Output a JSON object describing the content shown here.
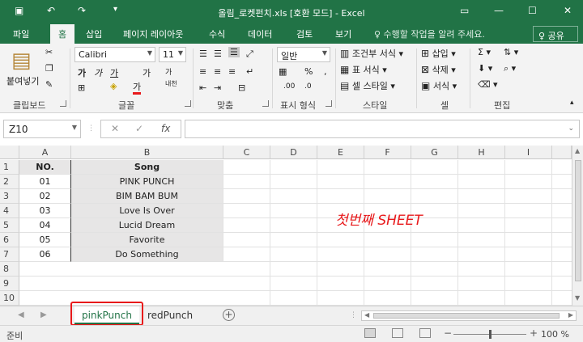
{
  "title": "올림_로켓펀치.xls  [호환 모드] - Excel",
  "ribbon_tabs": [
    "파일",
    "홈",
    "삽입",
    "페이지 레이아웃",
    "수식",
    "데이터",
    "검토",
    "보기"
  ],
  "tell_me": "♀ 수행할 작업을 알려 주세요.",
  "share": "♀ 공유",
  "clipboard": {
    "paste": "붙여넣기",
    "label": "클립보드"
  },
  "font": {
    "name": "Calibri",
    "size": "11",
    "label": "글꼴",
    "bold": "가",
    "italic": "가",
    "underline": "가",
    "grow": "가",
    "shrink": "가",
    "color_a": "가",
    "phonetic": "내천"
  },
  "alignment": {
    "label": "맞춤"
  },
  "number": {
    "format": "일반",
    "percent": "%",
    "comma": ",",
    "label": "표시 형식"
  },
  "styles": {
    "conditional": "조건부 서식",
    "table": "표 서식",
    "cell": "셀 스타일",
    "label": "스타일"
  },
  "cells": {
    "insert": "삽입",
    "delete": "삭제",
    "format": "서식",
    "label": "셀"
  },
  "editing": {
    "label": "편집"
  },
  "name_box": "Z10",
  "fx": "fx",
  "columns": [
    "A",
    "B",
    "C",
    "D",
    "E",
    "F",
    "G",
    "H",
    "I"
  ],
  "rows": [
    "1",
    "2",
    "3",
    "4",
    "5",
    "6",
    "7",
    "8",
    "9",
    "10"
  ],
  "table": {
    "headers": [
      "NO.",
      "Song"
    ],
    "rows": [
      [
        "01",
        "PINK PUNCH"
      ],
      [
        "02",
        "BIM BAM BUM"
      ],
      [
        "03",
        "Love Is Over"
      ],
      [
        "04",
        "Lucid Dream"
      ],
      [
        "05",
        "Favorite"
      ],
      [
        "06",
        "Do Something"
      ]
    ]
  },
  "annotation": "첫번째 SHEET",
  "sheets": [
    "pinkPunch",
    "redPunch"
  ],
  "status": "준비",
  "zoom": "100 %",
  "colors": {
    "accent": "#217346",
    "highlight": "#e8191b"
  }
}
